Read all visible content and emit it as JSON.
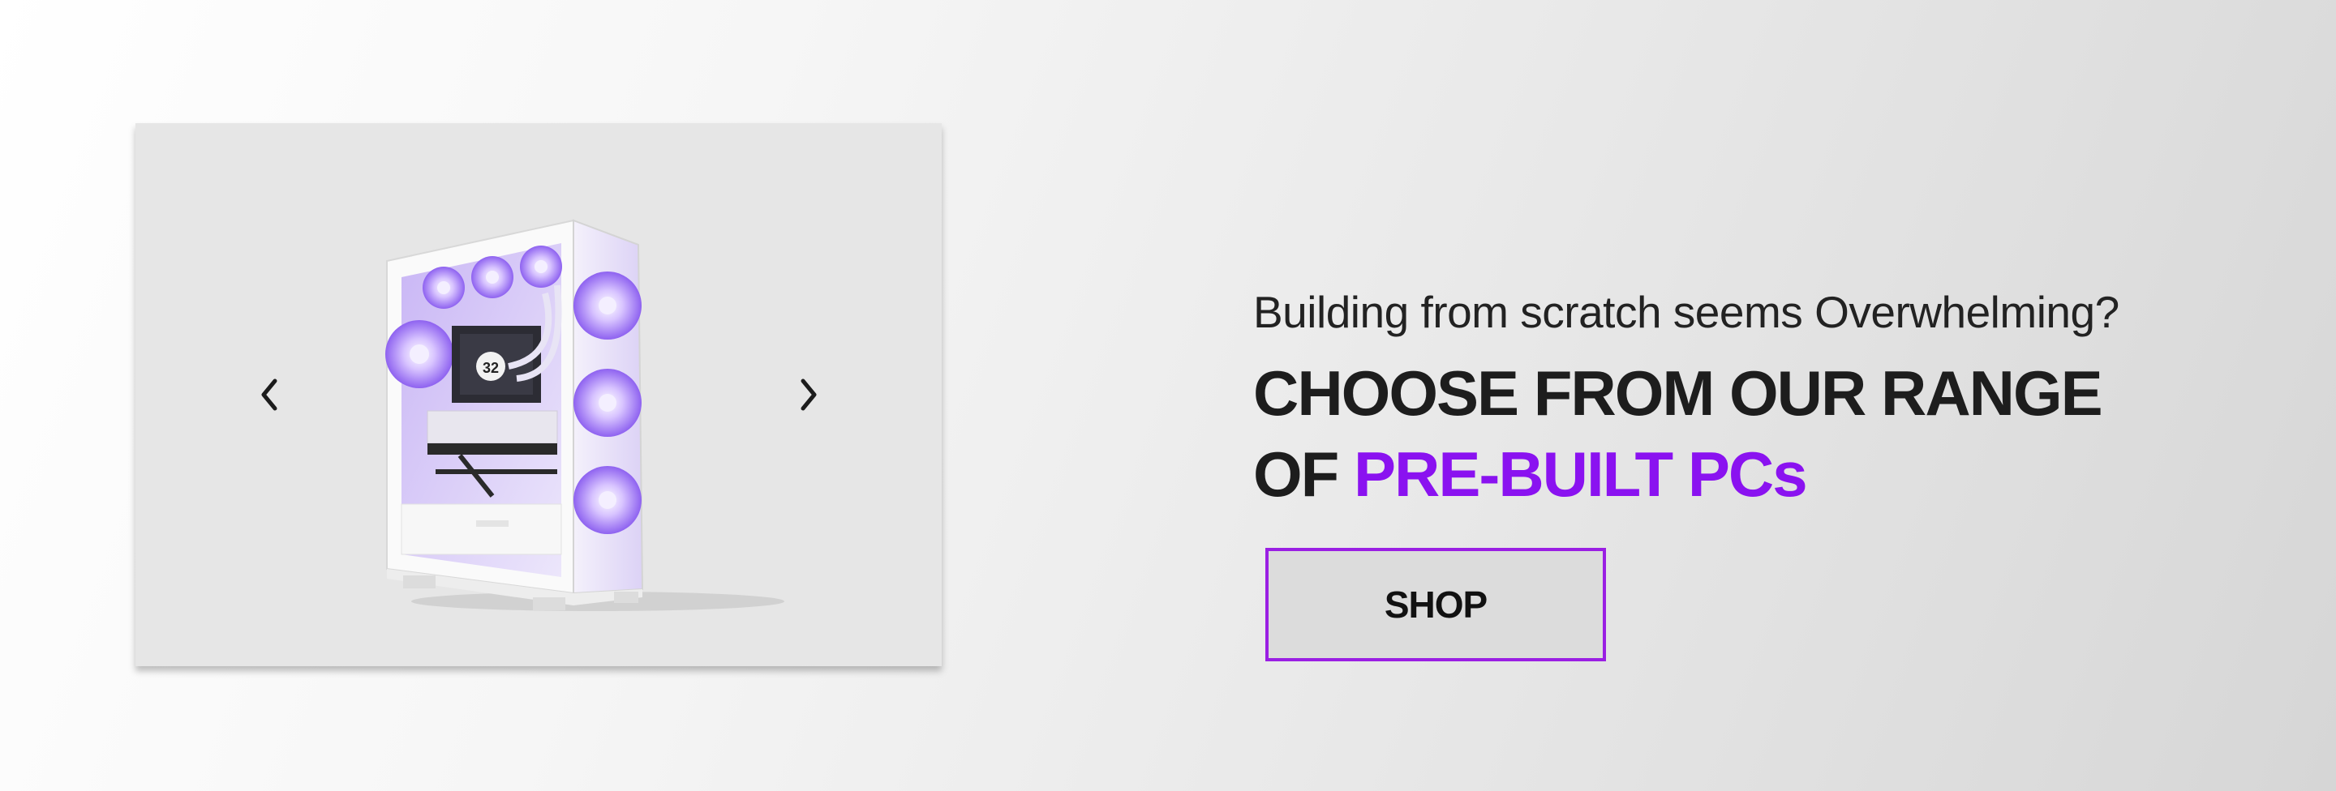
{
  "carousel": {
    "image_alt": "white pc case with purple fans",
    "prev_icon": "chevron-left-icon",
    "next_icon": "chevron-right-icon",
    "fan_display_value": "32"
  },
  "copy": {
    "subheading": "Building from scratch seems Overwhelming?",
    "headline_line1": "CHOOSE FROM OUR RANGE",
    "headline_line2_prefix": "OF ",
    "headline_line2_accent": "PRE-BUILT PCs"
  },
  "cta": {
    "label": "SHOP"
  },
  "colors": {
    "accent": "#8a12f0",
    "button_border": "#9a1fe3",
    "text_dark": "#1d1d1d",
    "fan_glow": "#b38cff"
  }
}
